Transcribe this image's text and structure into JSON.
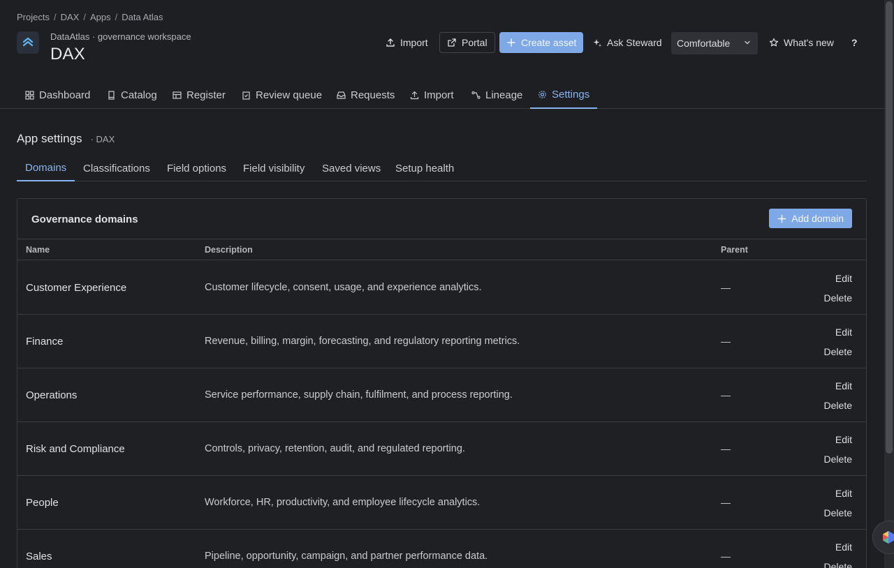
{
  "breadcrumb": [
    "Projects",
    "DAX",
    "Apps",
    "Data Atlas"
  ],
  "header": {
    "subtitle": "DataAtlas · governance workspace",
    "title": "DAX"
  },
  "actions": {
    "import": "Import",
    "portal": "Portal",
    "create_asset": "Create asset",
    "ask_steward": "Ask Steward",
    "density": "Comfortable",
    "whats_new": "What's new",
    "help": "?"
  },
  "main_tabs": [
    "Dashboard",
    "Catalog",
    "Register",
    "Review queue",
    "Requests",
    "Import",
    "Lineage",
    "Settings"
  ],
  "settings": {
    "title": "App settings",
    "scope": "· DAX",
    "tabs": [
      "Domains",
      "Classifications",
      "Field options",
      "Field visibility",
      "Saved views",
      "Setup health"
    ]
  },
  "domains": {
    "title": "Governance domains",
    "add_label": "Add domain",
    "columns": {
      "name": "Name",
      "description": "Description",
      "parent": "Parent"
    },
    "edit_label": "Edit",
    "delete_label": "Delete",
    "rows": [
      {
        "name": "Customer Experience",
        "description": "Customer lifecycle, consent, usage, and experience analytics.",
        "parent": "—"
      },
      {
        "name": "Finance",
        "description": "Revenue, billing, margin, forecasting, and regulatory reporting metrics.",
        "parent": "—"
      },
      {
        "name": "Operations",
        "description": "Service performance, supply chain, fulfilment, and process reporting.",
        "parent": "—"
      },
      {
        "name": "Risk and Compliance",
        "description": "Controls, privacy, retention, audit, and regulated reporting.",
        "parent": "—"
      },
      {
        "name": "People",
        "description": "Workforce, HR, productivity, and employee lifecycle analytics.",
        "parent": "—"
      },
      {
        "name": "Sales",
        "description": "Pipeline, opportunity, campaign, and partner performance data.",
        "parent": "—"
      }
    ]
  },
  "colors": {
    "accent": "#8ab4f0",
    "primary_button": "#7fa9e6",
    "background": "#1e1f22"
  }
}
